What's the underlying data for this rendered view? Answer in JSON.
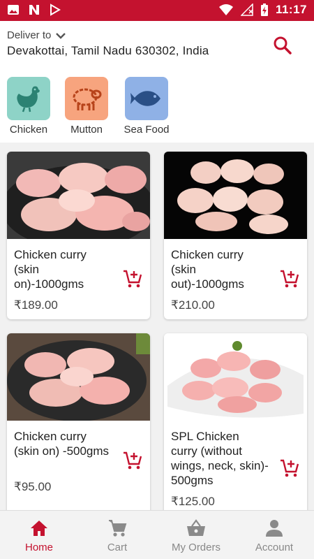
{
  "status_bar": {
    "time": "11:17"
  },
  "header": {
    "deliver_label": "Deliver to",
    "address": "Devakottai, Tamil Nadu 630302, India"
  },
  "categories": [
    {
      "label": "Chicken",
      "color": "#8ed3c7",
      "icon": "chicken-icon"
    },
    {
      "label": "Mutton",
      "color": "#f7a47e",
      "icon": "sheep-icon"
    },
    {
      "label": "Sea Food",
      "color": "#8fb1e6",
      "icon": "fish-icon"
    }
  ],
  "products": [
    {
      "name": "Chicken curry (skin on)-1000gms",
      "price": "₹189.00"
    },
    {
      "name": "Chicken curry (skin out)-1000gms",
      "price": "₹210.00"
    },
    {
      "name": "Chicken curry (skin on) -500gms",
      "price": "₹95.00"
    },
    {
      "name": "SPL Chicken curry (without wings, neck, skin)- 500gms",
      "price": "₹125.00"
    }
  ],
  "nav": [
    {
      "label": "Home",
      "active": true
    },
    {
      "label": "Cart",
      "active": false
    },
    {
      "label": "My Orders",
      "active": false
    },
    {
      "label": "Account",
      "active": false
    }
  ],
  "colors": {
    "brand": "#c4122f",
    "inactive": "#8a8a8a"
  }
}
